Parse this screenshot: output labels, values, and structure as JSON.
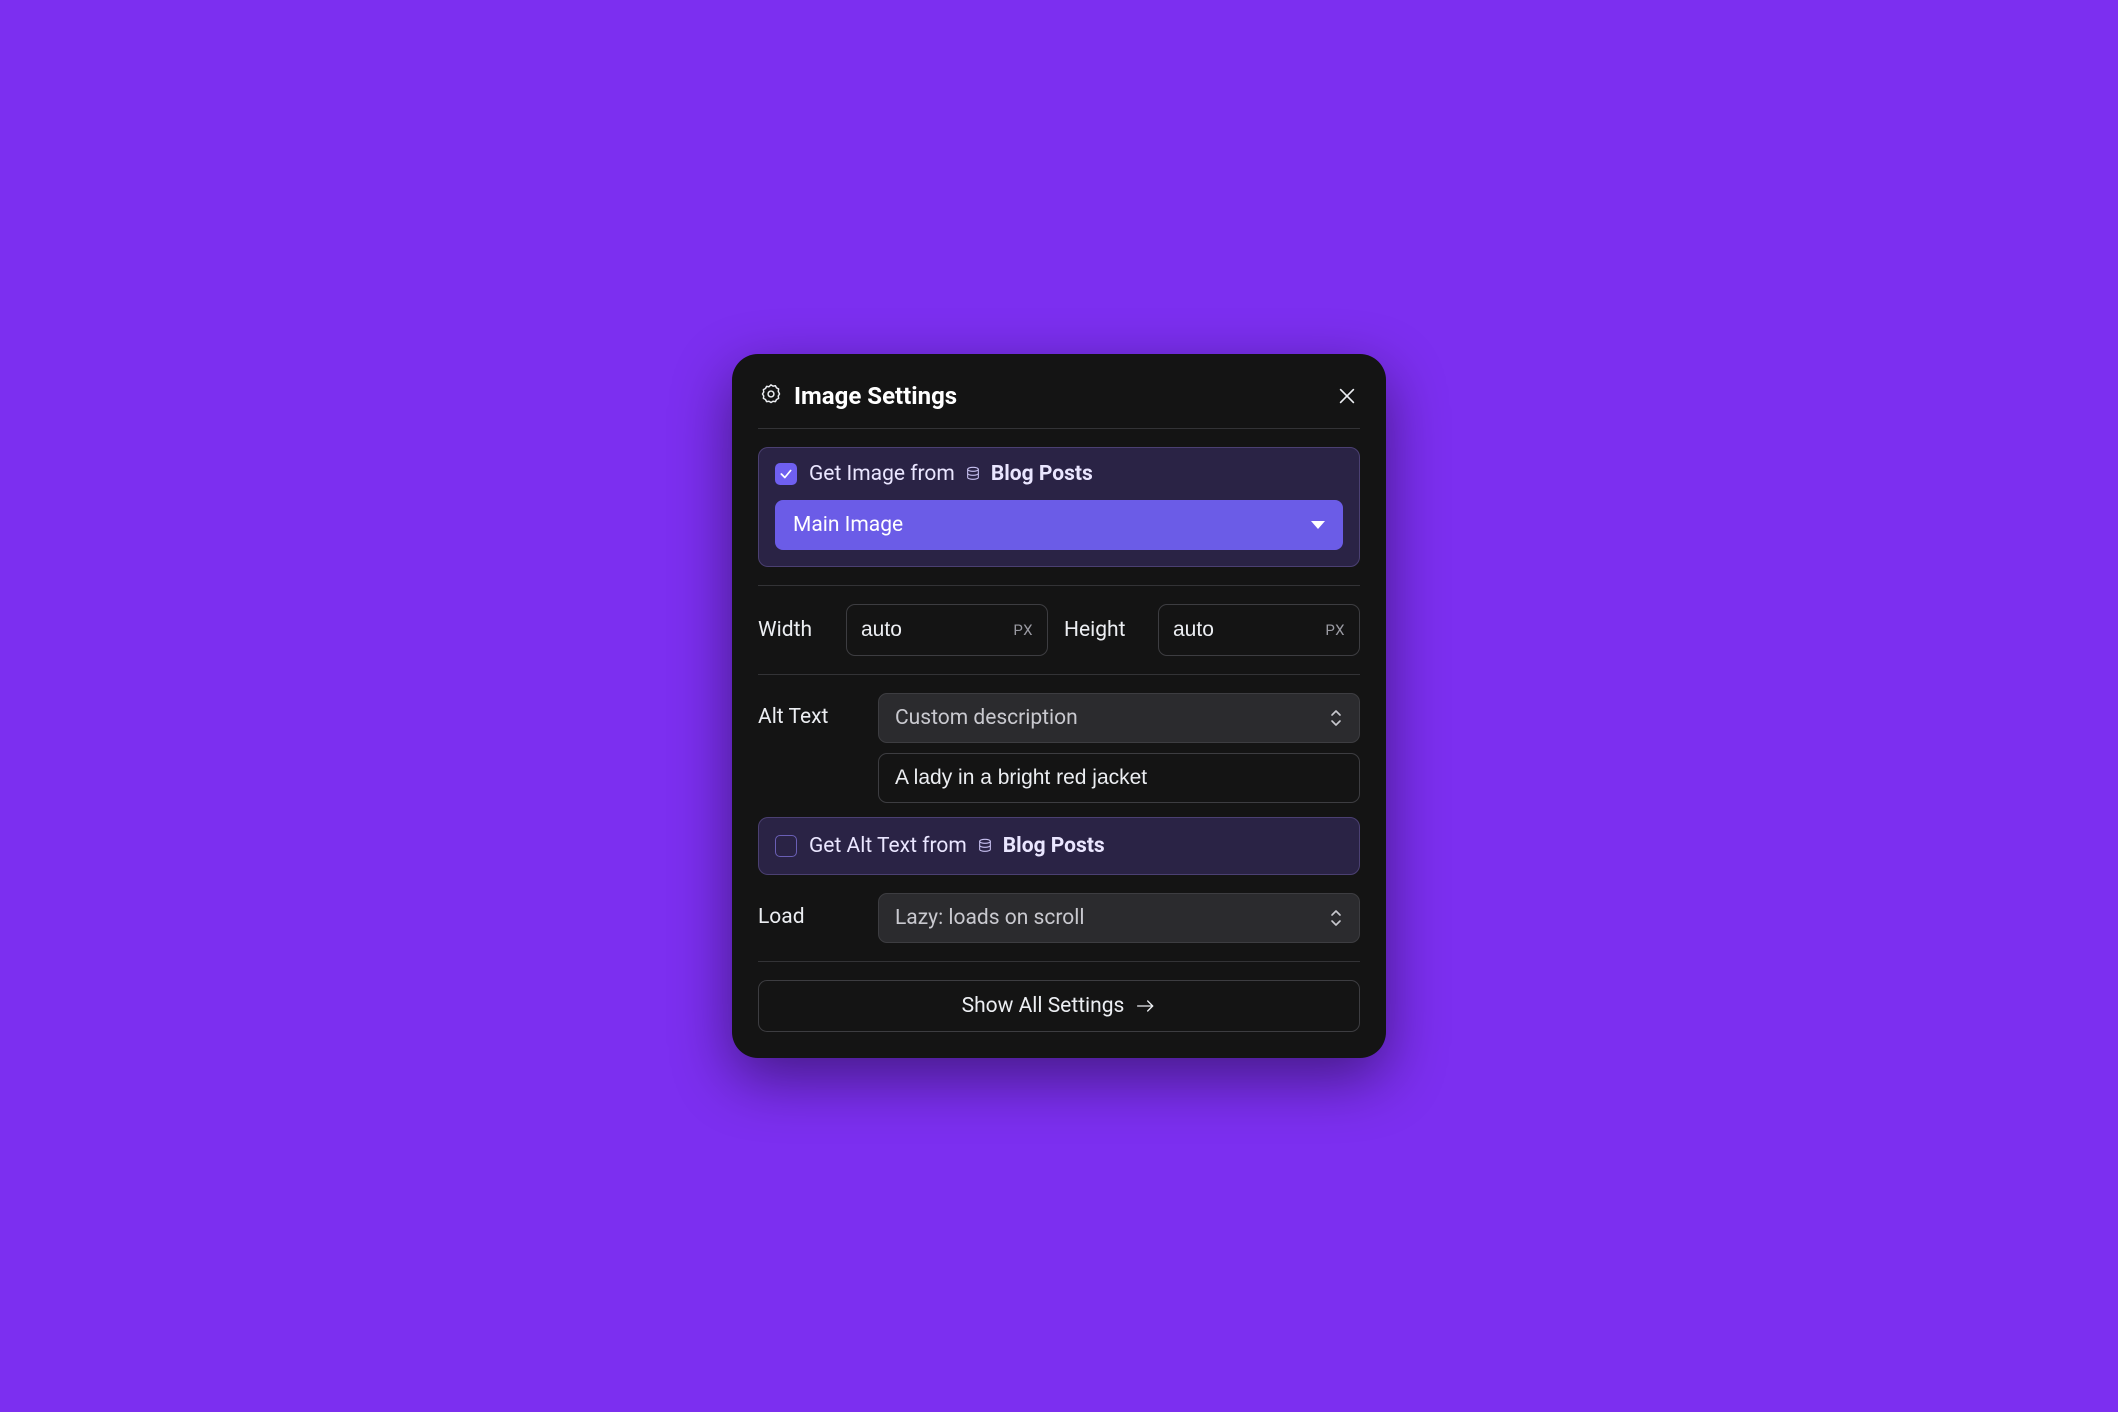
{
  "header": {
    "title": "Image Settings"
  },
  "imageSource": {
    "checked": true,
    "prefix": "Get Image from",
    "collection": "Blog Posts",
    "field": "Main Image"
  },
  "dimensions": {
    "widthLabel": "Width",
    "widthValue": "auto",
    "widthUnit": "PX",
    "heightLabel": "Height",
    "heightValue": "auto",
    "heightUnit": "PX"
  },
  "altText": {
    "label": "Alt Text",
    "mode": "Custom description",
    "value": "A lady in a bright red jacket",
    "bindChecked": false,
    "bindPrefix": "Get Alt Text from",
    "bindCollection": "Blog Posts"
  },
  "load": {
    "label": "Load",
    "value": "Lazy: loads on scroll"
  },
  "footer": {
    "showAll": "Show All Settings"
  }
}
